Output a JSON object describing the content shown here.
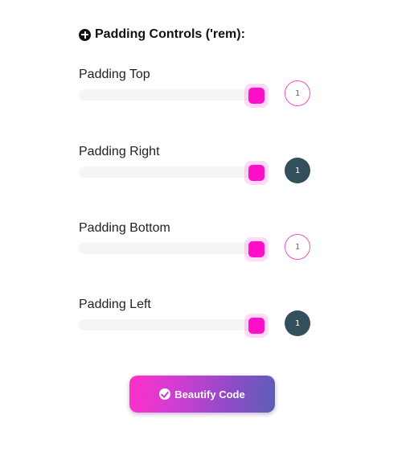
{
  "header": {
    "title": "Padding Controls ('rem):",
    "icon": "plus-circle-icon"
  },
  "controls": [
    {
      "label": "Padding Top",
      "value": "1",
      "badge_style": "outline"
    },
    {
      "label": "Padding Right",
      "value": "1",
      "badge_style": "filled"
    },
    {
      "label": "Padding Bottom",
      "value": "1",
      "badge_style": "outline"
    },
    {
      "label": "Padding Left",
      "value": "1",
      "badge_style": "filled"
    }
  ],
  "button": {
    "label": "Beautify Code",
    "icon": "check-circle-icon"
  },
  "colors": {
    "accent": "#ff10c8",
    "badge_filled": "#334f5c",
    "track": "#f5f5f8"
  }
}
